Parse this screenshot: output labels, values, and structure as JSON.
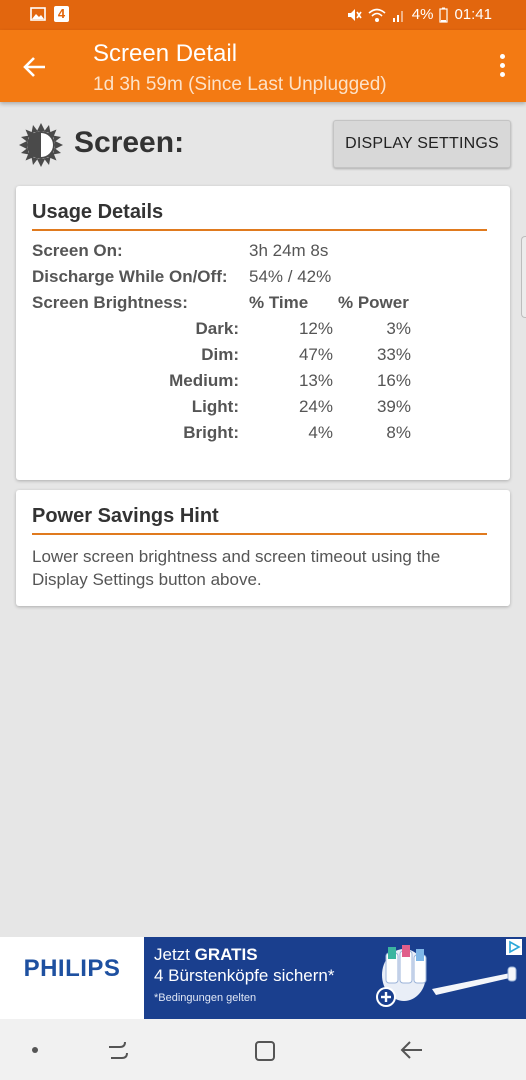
{
  "status_bar": {
    "notification_count": "4",
    "battery": "4%",
    "time": "01:41"
  },
  "app_bar": {
    "title": "Screen Detail",
    "subtitle": "1d 3h 59m (Since Last Unplugged)"
  },
  "header": {
    "heading": "Screen:",
    "display_settings_label": "DISPLAY SETTINGS"
  },
  "usage": {
    "title": "Usage Details",
    "screen_on_label": "Screen On:",
    "screen_on_value": "3h 24m 8s",
    "discharge_label": "Discharge While On/Off:",
    "discharge_value": "54% / 42%",
    "brightness_label": "Screen Brightness:",
    "col_time": "% Time",
    "col_power": "% Power",
    "rows": [
      {
        "level": "Dark:",
        "time": "12%",
        "power": "3%"
      },
      {
        "level": "Dim:",
        "time": "47%",
        "power": "33%"
      },
      {
        "level": "Medium:",
        "time": "13%",
        "power": "16%"
      },
      {
        "level": "Light:",
        "time": "24%",
        "power": "39%"
      },
      {
        "level": "Bright:",
        "time": "4%",
        "power": "8%"
      }
    ]
  },
  "hint": {
    "title": "Power Savings Hint",
    "text": "Lower screen brightness and screen timeout using the Display Settings button above."
  },
  "ad": {
    "brand": "PHILIPS",
    "line1_prefix": "Jetzt ",
    "line1_bold": "GRATIS",
    "line2": "4 Bürstenköpfe sichern*",
    "line3": "*Bedingungen gelten"
  },
  "colors": {
    "app_bar": "#f37a13",
    "status_bar": "#e2660e",
    "accent_rule": "#e07a1e",
    "ad_background": "#1a3f8e"
  },
  "icons": [
    "gallery-icon",
    "mute-icon",
    "wifi-icon",
    "signal-icon",
    "back-arrow-icon",
    "overflow-menu-icon",
    "brightness-icon",
    "adchoices-icon",
    "toothbrush-icon",
    "nav-dot-icon",
    "recents-icon",
    "home-icon",
    "nav-back-icon"
  ]
}
